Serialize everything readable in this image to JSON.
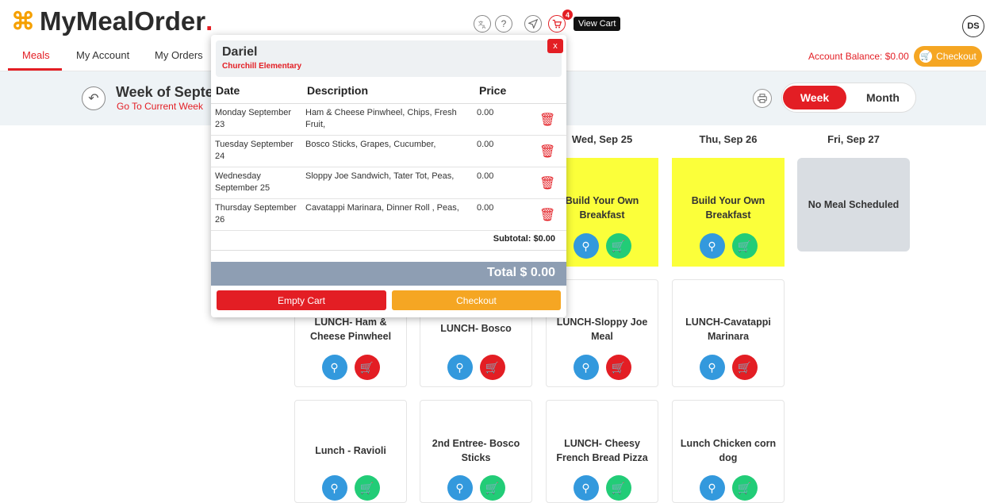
{
  "header": {
    "logo_mark": "⌘",
    "logo_text": "MyMealOrder",
    "logo_dot": ".",
    "cart_count": "4",
    "view_cart_tooltip": "View Cart",
    "avatar_initials": "DS",
    "icons": [
      "translate-icon",
      "help-icon",
      "send-icon",
      "cart-icon"
    ]
  },
  "nav": {
    "items": [
      "Meals",
      "My Account",
      "My Orders"
    ],
    "active": "Meals",
    "balance": "Account Balance: $0.00",
    "checkout": "Checkout"
  },
  "week": {
    "title": "Week of Septer",
    "current_link": "Go To Current Week",
    "view_week": "Week",
    "view_month": "Month"
  },
  "days": [
    "Wed, Sep 25",
    "Thu, Sep 26",
    "Fri, Sep 27"
  ],
  "cards": {
    "wed_breakfast": "Build Your Own Breakfast",
    "thu_breakfast": "Build Your Own Breakfast",
    "fri_none": "No Meal Scheduled",
    "lunch1": [
      "LUNCH- Ham & Cheese Pinwheel",
      "LUNCH- Bosco",
      "LUNCH-Sloppy Joe Meal",
      "LUNCH-Cavatappi Marinara"
    ],
    "lunch2": [
      "Lunch - Ravioli",
      "2nd Entree- Bosco Sticks",
      "LUNCH- Cheesy French Bread Pizza",
      "Lunch Chicken corn dog"
    ]
  },
  "cart": {
    "student": "Dariel",
    "school": "Churchill Elementary",
    "close": "x",
    "headers": {
      "date": "Date",
      "description": "Description",
      "price": "Price"
    },
    "rows": [
      {
        "date": "Monday September 23",
        "description": "Ham & Cheese Pinwheel, Chips, Fresh Fruit,",
        "price": "0.00"
      },
      {
        "date": "Tuesday September 24",
        "description": "Bosco Sticks, Grapes, Cucumber,",
        "price": "0.00"
      },
      {
        "date": "Wednesday September 25",
        "description": "Sloppy Joe Sandwich, Tater Tot, Peas,",
        "price": "0.00"
      },
      {
        "date": "Thursday September 26",
        "description": "Cavatappi Marinara, Dinner Roll , Peas,",
        "price": "0.00"
      }
    ],
    "subtotal": "Subtotal: $0.00",
    "total": "Total $ 0.00",
    "empty_cart": "Empty Cart",
    "checkout": "Checkout"
  }
}
